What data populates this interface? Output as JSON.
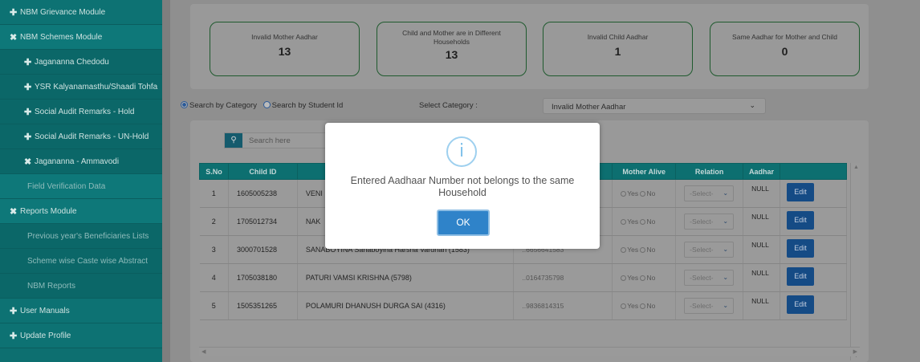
{
  "sidebar": {
    "items": [
      {
        "icon": "plus",
        "label": "NBM Grievance Module"
      },
      {
        "icon": "x",
        "label": "NBM Schemes Module"
      },
      {
        "icon": "plus",
        "label": "Jagananna Chedodu"
      },
      {
        "icon": "plus",
        "label": "YSR Kalyanamasthu/Shaadi Tohfa"
      },
      {
        "icon": "plus",
        "label": "Social Audit Remarks - Hold"
      },
      {
        "icon": "plus",
        "label": "Social Audit Remarks - UN-Hold"
      },
      {
        "icon": "x",
        "label": "Jagananna - Ammavodi"
      },
      {
        "icon": "",
        "label": "Field Verification Data"
      },
      {
        "icon": "x",
        "label": "Reports Module"
      },
      {
        "icon": "",
        "label": "Previous year's Beneficiaries Lists"
      },
      {
        "icon": "",
        "label": "Scheme wise Caste wise Abstract"
      },
      {
        "icon": "",
        "label": "NBM Reports"
      },
      {
        "icon": "plus",
        "label": "User Manuals"
      },
      {
        "icon": "plus",
        "label": "Update Profile"
      }
    ]
  },
  "cards": [
    {
      "label": "Invalid Mother Aadhar",
      "value": "13"
    },
    {
      "label": "Child and Mother are in Different Households",
      "value": "13"
    },
    {
      "label": "Invalid Child Aadhar",
      "value": "1"
    },
    {
      "label": "Same Aadhar for Mother and Child",
      "value": "0"
    }
  ],
  "search": {
    "by_category": "Search by Category",
    "by_student": "Search by Student Id",
    "category_label": "Select Category :",
    "category_value": "Invalid Mother Aadhar",
    "placeholder": "Search here"
  },
  "table": {
    "headers": [
      "S.No",
      "Child ID",
      "",
      "",
      "Mother Alive",
      "Relation",
      "Aadhar",
      ""
    ],
    "yes_label": "Yes",
    "no_label": "No",
    "select_label": "-Select-",
    "edit_label": "Edit",
    "rows": [
      {
        "sno": "1",
        "child_id": "1605005238",
        "name": "VENI",
        "aadhar_tail": "",
        "aadhar": "NULL"
      },
      {
        "sno": "2",
        "child_id": "1705012734",
        "name": "NAK",
        "aadhar_tail": "",
        "aadhar": "NULL"
      },
      {
        "sno": "3",
        "child_id": "3000701528",
        "name": "SANABOYINA Sanaboyina Harsha Vardhan (1583)",
        "aadhar_tail": "..6656641583",
        "aadhar": "NULL"
      },
      {
        "sno": "4",
        "child_id": "1705038180",
        "name": "PATURI VAMSI KRISHNA (5798)",
        "aadhar_tail": "..0164735798",
        "aadhar": "NULL"
      },
      {
        "sno": "5",
        "child_id": "1505351265",
        "name": "POLAMURI DHANUSH DURGA SAI (4316)",
        "aadhar_tail": "..9836814315",
        "aadhar": "NULL"
      }
    ]
  },
  "modal": {
    "icon": "info-icon",
    "message": "Entered Aadhaar Number not belongs to the same Household",
    "ok_label": "OK"
  }
}
